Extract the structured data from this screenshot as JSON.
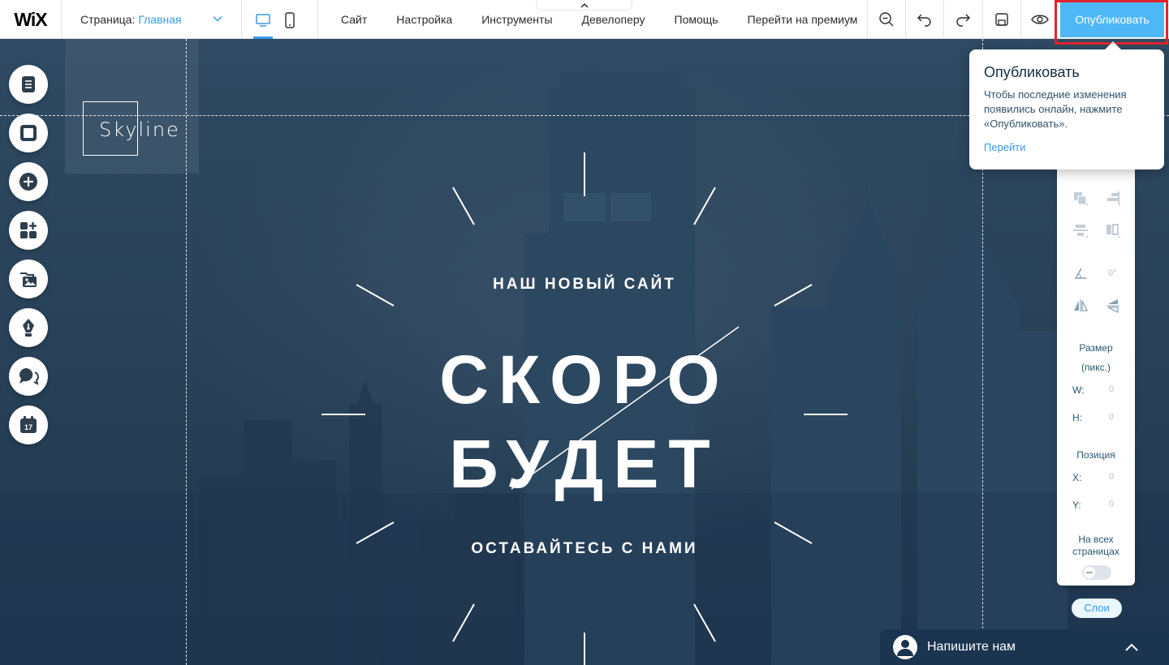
{
  "topbar": {
    "logo": "WiX",
    "page_label": "Страница:",
    "page_name": "Главная",
    "menu": [
      "Сайт",
      "Настройка",
      "Инструменты",
      "Девелоперу",
      "Помощь",
      "Перейти на премиум"
    ],
    "publish_label": "Опубликовать"
  },
  "site": {
    "brand": "Skyline",
    "hero_subtitle": "НАШ НОВЫЙ САЙТ",
    "hero_title_line1": "СКОРО",
    "hero_title_line2": "БУДЕТ",
    "hero_tagline": "ОСТАВАЙТЕСЬ С НАМИ"
  },
  "tooltip": {
    "title": "Опубликовать",
    "body": "Чтобы последние изменения появились онлайн, нажмите «Опубликовать».",
    "link": "Перейти"
  },
  "panel": {
    "rotation": "0°",
    "size_label_1": "Размер",
    "size_label_2": "(пикс.)",
    "w_label": "W:",
    "w_value": "0",
    "h_label": "H:",
    "h_value": "0",
    "position_label": "Позиция",
    "x_label": "X:",
    "x_value": "0",
    "y_label": "Y:",
    "y_value": "0",
    "all_pages_1": "На всех",
    "all_pages_2": "страницах",
    "all_pages_on": false,
    "layers_label": "Слои"
  },
  "chat": {
    "label": "Напишите нам"
  },
  "rail_icons": [
    "pages-icon",
    "background-icon",
    "add-icon",
    "app-market-icon",
    "media-icon",
    "blog-icon",
    "chat-bubble-icon",
    "bookings-calendar-icon"
  ],
  "rail_calendar_day": "17",
  "colors": {
    "accent": "#3899ec",
    "publish": "#4eb7f5",
    "highlight": "#e0242c",
    "stage": "#2a435a"
  }
}
